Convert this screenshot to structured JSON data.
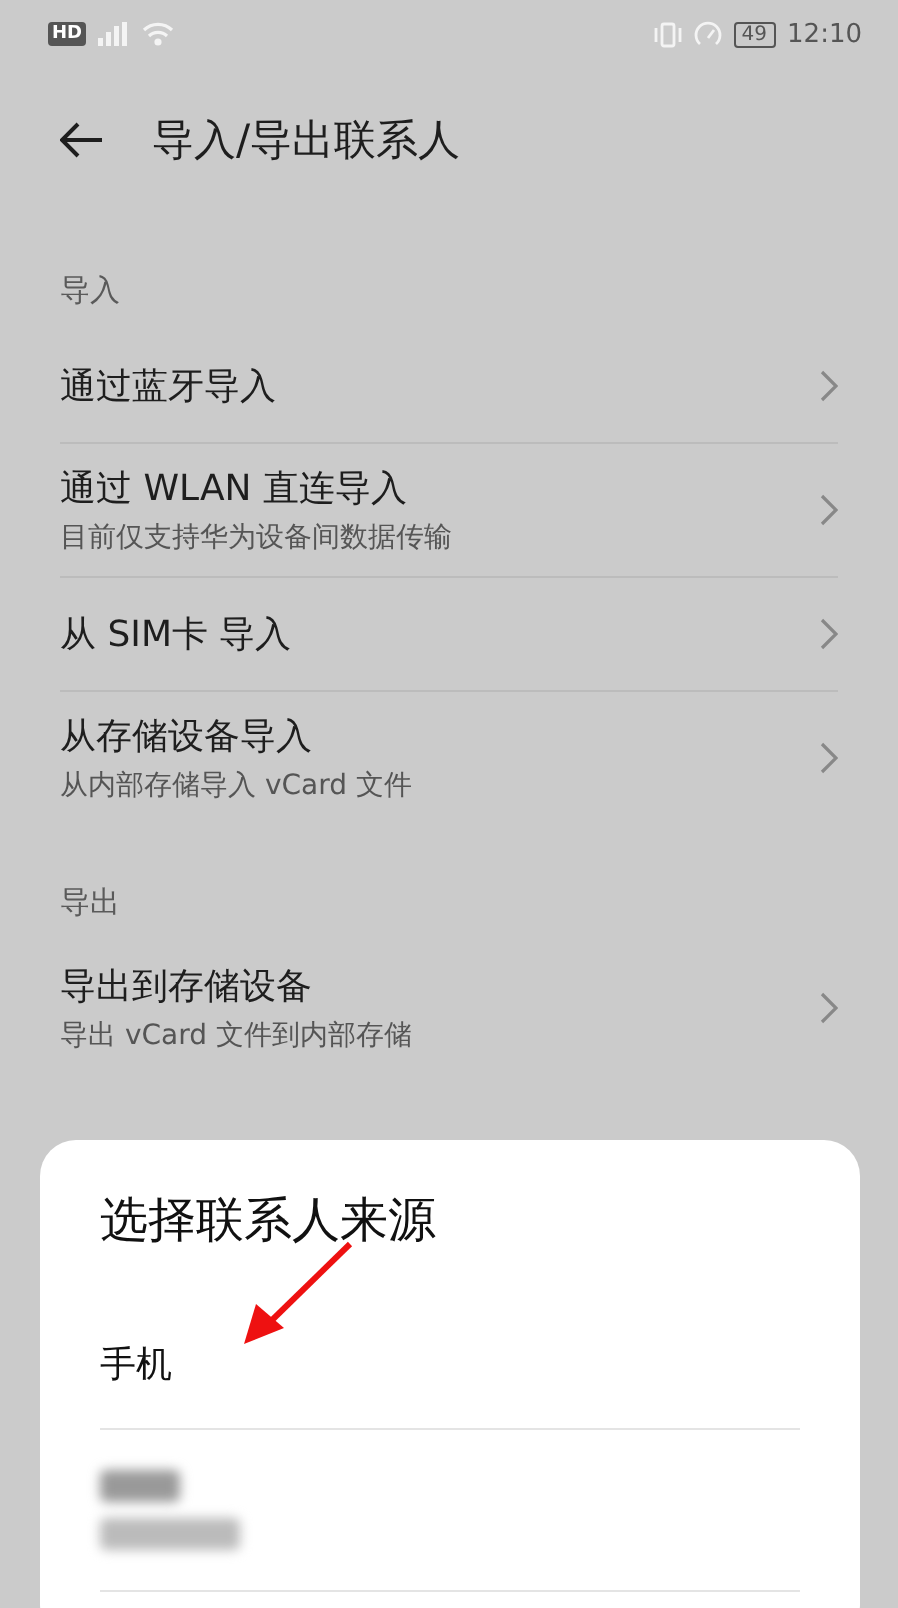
{
  "status_bar": {
    "hd": "HD",
    "battery": "49",
    "time": "12:10"
  },
  "header": {
    "title": "导入/导出联系人"
  },
  "sections": [
    {
      "title": "导入",
      "items": [
        {
          "title": "通过蓝牙导入"
        },
        {
          "title": "通过 WLAN 直连导入",
          "subtitle": "目前仅支持华为设备间数据传输"
        },
        {
          "title": "从 SIM卡 导入"
        },
        {
          "title": "从存储设备导入",
          "subtitle": "从内部存储导入 vCard 文件"
        }
      ]
    },
    {
      "title": "导出",
      "items": [
        {
          "title": "导出到存储设备",
          "subtitle": "导出 vCard 文件到内部存储"
        }
      ]
    }
  ],
  "dialog": {
    "title": "选择联系人来源",
    "options": [
      {
        "kind": "text",
        "label": "手机"
      },
      {
        "kind": "blurred"
      }
    ]
  }
}
